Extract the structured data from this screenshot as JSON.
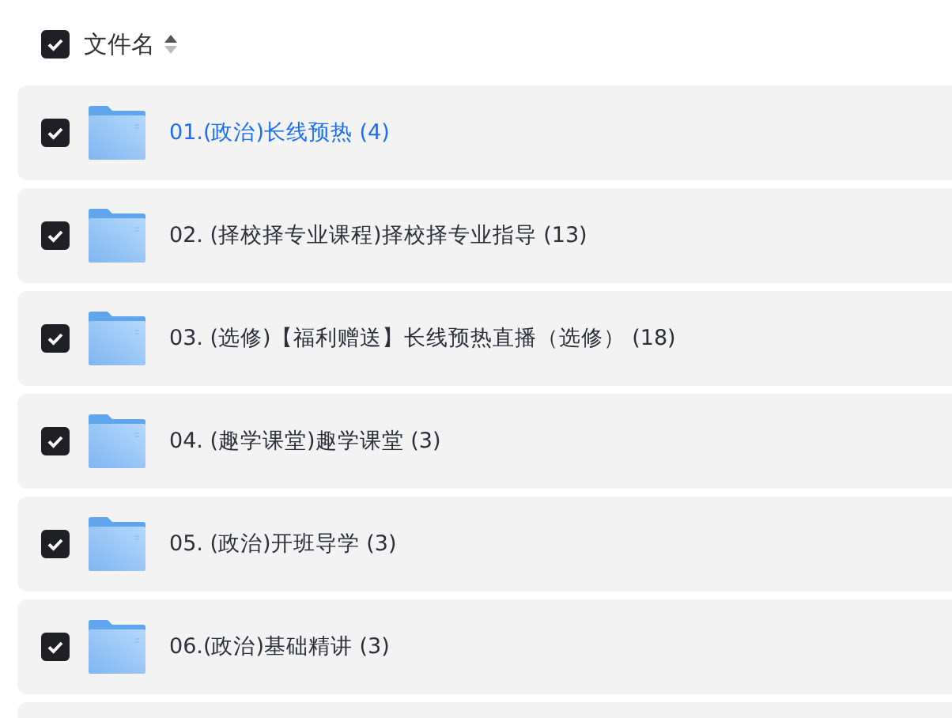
{
  "header": {
    "checked": true,
    "label": "文件名"
  },
  "rows": [
    {
      "name": "01.(政治)长线预热 (4)",
      "checked": true,
      "hovered": true
    },
    {
      "name": "02. (择校择专业课程)择校择专业指导 (13)",
      "checked": true,
      "hovered": false
    },
    {
      "name": "03. (选修)【福利赠送】长线预热直播（选修） (18)",
      "checked": true,
      "hovered": false
    },
    {
      "name": "04. (趣学课堂)趣学课堂 (3)",
      "checked": true,
      "hovered": false
    },
    {
      "name": "05. (政治)开班导学 (3)",
      "checked": true,
      "hovered": false
    },
    {
      "name": "06.(政治)基础精讲 (3)",
      "checked": true,
      "hovered": false
    }
  ]
}
